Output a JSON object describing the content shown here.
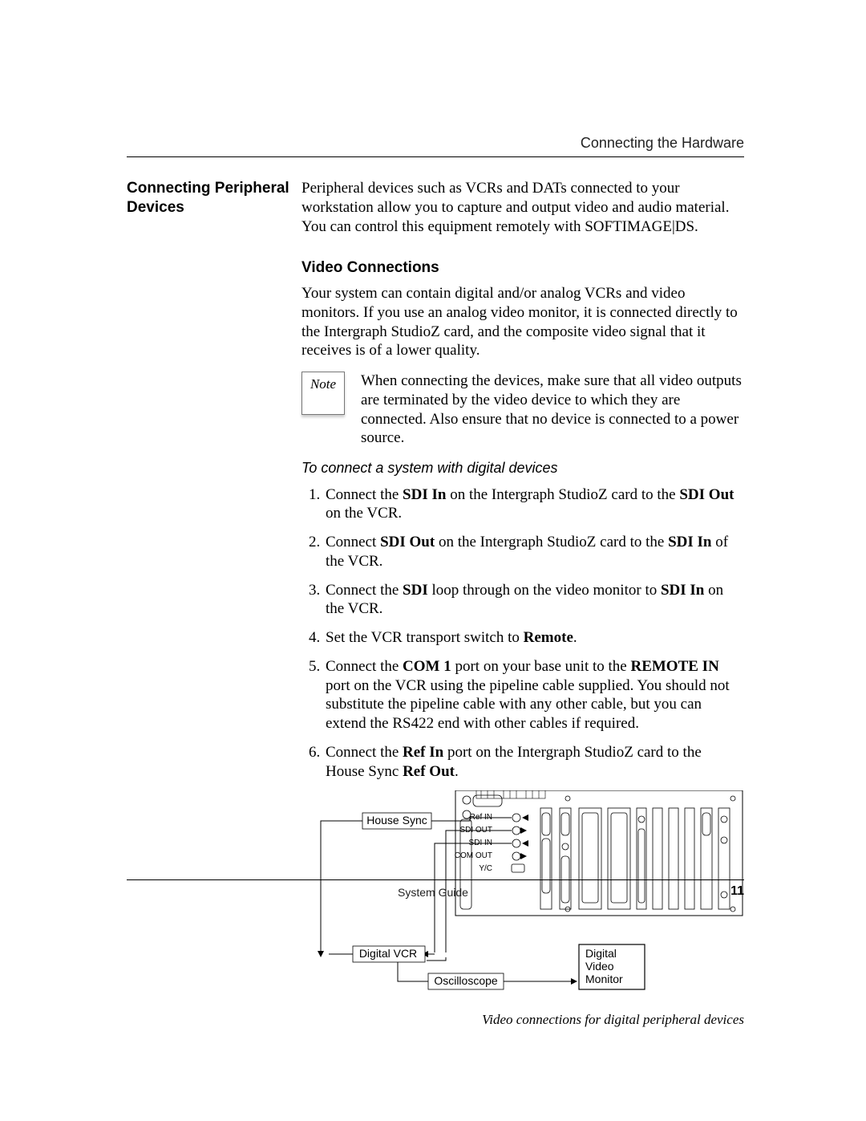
{
  "header_running": "Connecting the Hardware",
  "side_heading": "Connecting Peripheral Devices",
  "intro_paragraph_pre": "Peripheral devices such as VCRs and DATs connected to your workstation allow you to capture and output video and audio material. You can control this equipment remotely with ",
  "intro_paragraph_software": "SOFTIMAGE|DS.",
  "video_connections_heading": "Video Connections",
  "video_connections_paragraph": "Your system can contain digital and/or analog VCRs and video monitors. If you use an analog video monitor, it is connected directly to the Intergraph StudioZ card, and the composite video signal that it receives is of a lower quality.",
  "note_label": "Note",
  "note_text": "When connecting the devices, make sure that all video outputs are terminated by the video device to which they are connected. Also ensure that no device is connected to a power source.",
  "procedure_title": "To connect a system with digital devices",
  "steps": {
    "s1_a": "Connect the ",
    "s1_b": "SDI In",
    "s1_c": " on the Intergraph StudioZ card to the ",
    "s1_d": "SDI Out",
    "s1_e": " on the VCR.",
    "s2_a": "Connect ",
    "s2_b": "SDI Out",
    "s2_c": " on the Intergraph StudioZ card to the ",
    "s2_d": "SDI In",
    "s2_e": " of the VCR.",
    "s3_a": "Connect the ",
    "s3_b": "SDI",
    "s3_c": " loop through on the video monitor to ",
    "s3_d": "SDI In",
    "s3_e": " on the VCR.",
    "s4_a": "Set the VCR transport switch to ",
    "s4_b": "Remote",
    "s4_c": ".",
    "s5_a": "Connect the ",
    "s5_b": "COM 1",
    "s5_c": " port on your base unit to the ",
    "s5_d": "REMOTE IN",
    "s5_e": " port on the VCR using the pipeline cable supplied. You should not substitute the pipeline cable with any other cable, but you can extend the RS422 end with other cables if required.",
    "s6_a": "Connect the ",
    "s6_b": "Ref In",
    "s6_c": " port on the Intergraph StudioZ card to the House Sync ",
    "s6_d": "Ref Out",
    "s6_e": "."
  },
  "diagram": {
    "house_sync": "House Sync",
    "ref_in": "Ref IN",
    "sdi_out": "SDI OUT",
    "sdi_in": "SDI IN",
    "com_out": "COM OUT",
    "yc": "Y/C",
    "digital_vcr": "Digital VCR",
    "oscilloscope": "Oscilloscope",
    "digital_video_monitor_l1": "Digital",
    "digital_video_monitor_l2": "Video",
    "digital_video_monitor_l3": "Monitor"
  },
  "caption": "Video connections for digital peripheral devices",
  "footer_center": "System Guide",
  "footer_page": "11"
}
